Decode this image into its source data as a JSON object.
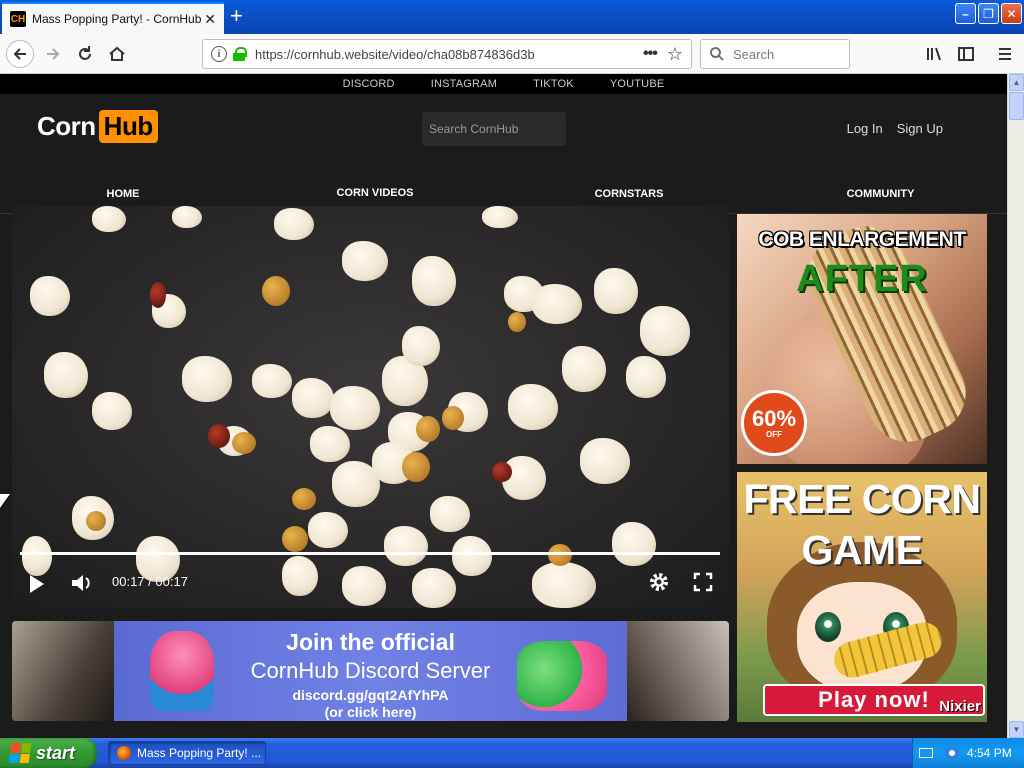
{
  "browser": {
    "tab_title": "Mass Popping Party! - CornHub",
    "tab_favicon": "CH",
    "new_tab": "+",
    "url": "https://cornhub.website/video/cha08b874836d3b",
    "search_placeholder": "Search"
  },
  "site": {
    "social_links": [
      "DISCORD",
      "INSTAGRAM",
      "TIKTOK",
      "YOUTUBE"
    ],
    "logo_text": "Corn",
    "logo_badge": "Hub",
    "search_placeholder": "Search CornHub",
    "login": "Log In",
    "signup": "Sign Up",
    "nav": [
      "HOME",
      "CORN VIDEOS",
      "CORNSTARS",
      "COMMUNITY"
    ],
    "nav_active_index": 1,
    "accent_color": "#ff9000"
  },
  "player": {
    "current_time": "00:17",
    "separator": "/",
    "duration": "00:17",
    "progress_fraction": 1.0
  },
  "discord_banner": {
    "line1": "Join the official",
    "line2": "CornHub Discord Server",
    "line3": "discord.gg/gqt2AfYhPA",
    "line4": "(or click here)"
  },
  "ads": {
    "ad1_headline": "COB ENLARGEMENT",
    "ad1_sub": "AFTER",
    "ad1_badge_pct": "60%",
    "ad1_badge_off": "OFF",
    "ad2_title_line1": "FREE CORN",
    "ad2_title_line2": "GAME",
    "ad2_button": "Play now!",
    "ad2_brand": "Nixier"
  },
  "taskbar": {
    "start_label": "start",
    "task_item_label": "Mass Popping Party! ...",
    "clock": "4:54 PM"
  }
}
